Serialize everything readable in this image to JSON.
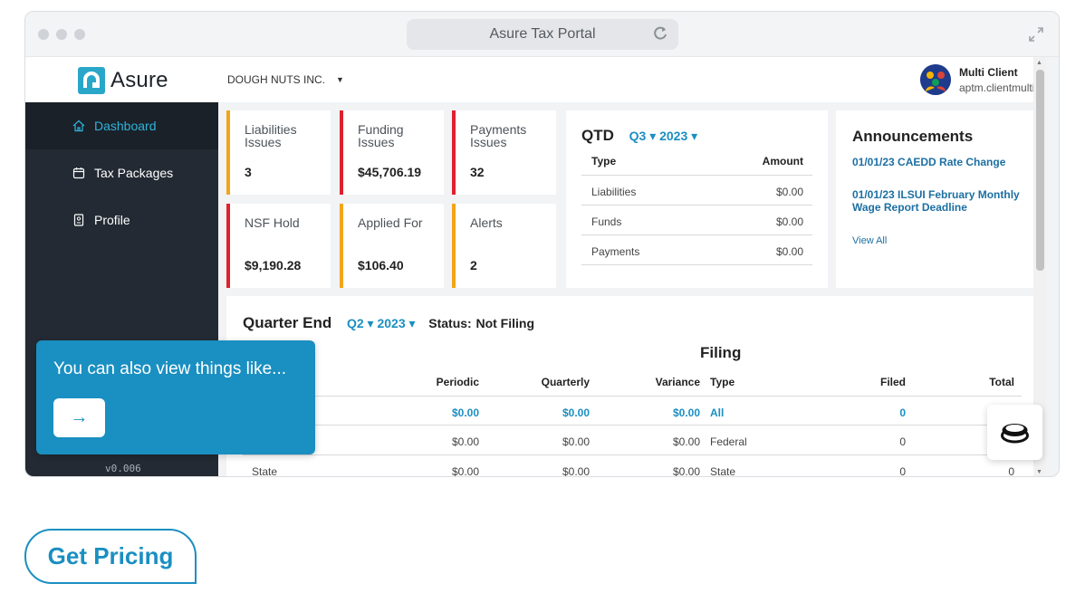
{
  "browser": {
    "title": "Asure Tax Portal"
  },
  "header": {
    "logo_text": "Asure",
    "company": "DOUGH NUTS INC.",
    "user_name": "Multi Client",
    "user_login": "aptm.clientmulti"
  },
  "sidebar": {
    "items": [
      {
        "label": "Dashboard",
        "icon": "home-icon",
        "active": true
      },
      {
        "label": "Tax Packages",
        "icon": "calendar-icon",
        "active": false
      },
      {
        "label": "Profile",
        "icon": "badge-icon",
        "active": false
      }
    ],
    "version": "v0.006"
  },
  "stats": [
    {
      "label": "Liabilities Issues",
      "value": "3",
      "accent": "#f2a51a"
    },
    {
      "label": "Funding Issues",
      "value": "$45,706.19",
      "accent": "#e0202e"
    },
    {
      "label": "Payments Issues",
      "value": "32",
      "accent": "#e0202e"
    },
    {
      "label": "NSF Hold",
      "value": "$9,190.28",
      "accent": "#e0202e"
    },
    {
      "label": "Applied For",
      "value": "$106.40",
      "accent": "#f2a51a"
    },
    {
      "label": "Alerts",
      "value": "2",
      "accent": "#f2a51a"
    }
  ],
  "qtd": {
    "title": "QTD",
    "period": "Q3 ▾ 2023 ▾",
    "col_type": "Type",
    "col_amount": "Amount",
    "rows": [
      {
        "type": "Liabilities",
        "amount": "$0.00"
      },
      {
        "type": "Funds",
        "amount": "$0.00"
      },
      {
        "type": "Payments",
        "amount": "$0.00"
      }
    ]
  },
  "announcements": {
    "title": "Announcements",
    "items": [
      "01/01/23 CAEDD Rate Change",
      "01/01/23 ILSUI February Monthly Wage Report Deadline"
    ],
    "view_all": "View All"
  },
  "quarter_end": {
    "title": "Quarter End",
    "period": "Q2 ▾ 2023 ▾",
    "status_label": "Status:",
    "status_value": "Not Filing",
    "left_headers": [
      "Periodic",
      "Quarterly",
      "Variance"
    ],
    "left_rows": [
      {
        "label": "",
        "periodic": "$0.00",
        "quarterly": "$0.00",
        "variance": "$0.00"
      },
      {
        "label": "",
        "periodic": "$0.00",
        "quarterly": "$0.00",
        "variance": "$0.00"
      },
      {
        "label": "State",
        "periodic": "$0.00",
        "quarterly": "$0.00",
        "variance": "$0.00"
      }
    ],
    "filing_title": "Filing",
    "filing_headers": [
      "Type",
      "Filed",
      "Total"
    ],
    "filing_rows": [
      {
        "type": "All",
        "filed": "0",
        "total": ""
      },
      {
        "type": "Federal",
        "filed": "0",
        "total": ""
      },
      {
        "type": "State",
        "filed": "0",
        "total": "0"
      }
    ]
  },
  "tooltip": {
    "message": "You can also view things like...",
    "next": "→"
  },
  "cta": {
    "label": "Get Pricing"
  },
  "colors": {
    "brand": "#1a8fc1",
    "sidebar": "#232a33",
    "warn": "#f2a51a",
    "alert": "#e0202e"
  }
}
